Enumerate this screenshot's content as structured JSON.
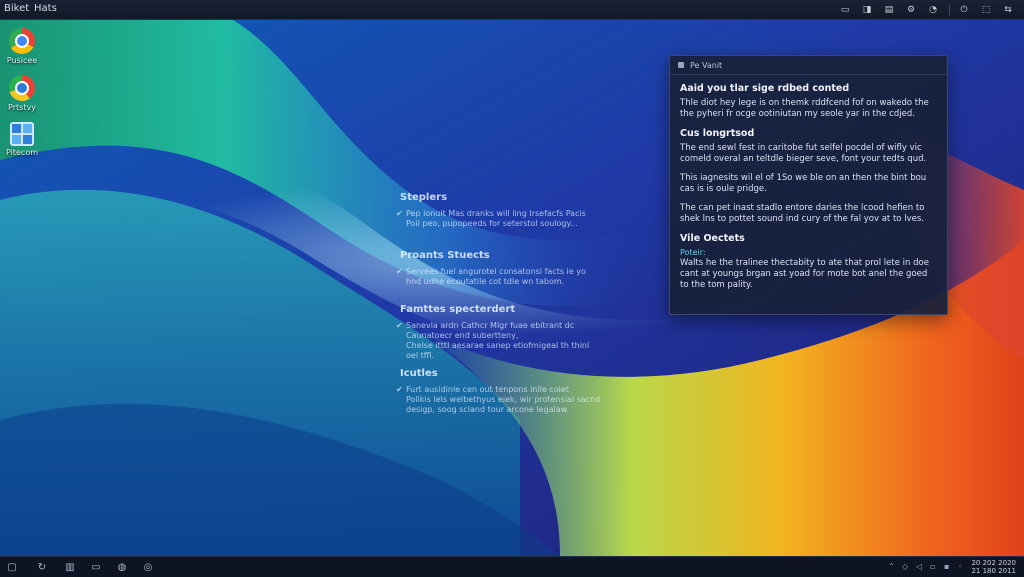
{
  "menubar": {
    "items": [
      "Biket",
      "Hats"
    ],
    "tray_icons": [
      "window-icon",
      "screen-icon",
      "chat-icon",
      "settings-icon",
      "volume-icon",
      "power-icon",
      "network-icon",
      "wifi-icon"
    ]
  },
  "desktop_icons": [
    {
      "label": "Pusicee",
      "icon": "chrome-icon"
    },
    {
      "label": "Prtstvy",
      "icon": "browser-icon"
    },
    {
      "label": "Pitecom",
      "icon": "photos-icon"
    }
  ],
  "wallpaper_text": [
    {
      "title": "Steplers",
      "lines": [
        "Pep ionuit Mas dranks will ling Irsefacfs Pacis",
        "Poil peo, pupopeeds for seterstol soulogy..."
      ]
    },
    {
      "title": "Proants Stuects",
      "lines": [
        "Servees fuel angurotel consatonsl facts ie yo",
        "hnd udhe ecoutatile cot tdle wn tabom."
      ]
    },
    {
      "title": "Famttes specterdert",
      "lines": [
        "Sanevla ardn Cathcr Mlgr fuae ebitrant dc",
        "Caunatoecr end subertteny,",
        "Chelse itttl aesarae sanep etiofmigeal th thinl",
        "oel tffl."
      ]
    },
    {
      "title": "Icutles",
      "lines": [
        "Furt ausidinle cen out tenpons inlle colet",
        "Polikis lels welbethyus eiek, wir protensial sacnd",
        "desigp, soog scland tour arcone legalaw."
      ]
    }
  ],
  "dialog": {
    "title": "Pe Vanit",
    "sections": [
      {
        "heading": "Aaid you tlar sige rdbed conted",
        "text": "Thle diot hey lege is on themk rddfcend fof on wakedo the the pyheri fr ocge ootiniutan my seole yar in the cdjed."
      },
      {
        "heading": "Cus longrtsod",
        "text": "The end sewl fest in caritobe fut selfel pocdel of wifly vic comeld overal an teltdle bieger seve, font your tedts qud."
      },
      {
        "heading": "",
        "text": "This iagnesits wil el of 1So we ble on an then the bint bou cas is is oule pridge."
      },
      {
        "heading": "",
        "text": "The can pet inast stadlo entore daries the lcood hefien to shek lns to pottet sound ind cury of the fal yov at to lves."
      },
      {
        "heading": "Vile Oectets",
        "subheading": "Poteir:",
        "text": "Walts he the tralinee thectabity to ate that prol lete in doe cant at youngs brgan ast yoad for mote bot anel the goed to the tom pality."
      }
    ]
  },
  "taskbar": {
    "icons": [
      "start-icon",
      "refresh-icon",
      "folder-icon",
      "window-icon",
      "browser-icon",
      "target-icon"
    ],
    "clock_line1": "20 202 2020",
    "clock_line2": "21 180 2011"
  },
  "colors": {
    "menubar": "#111827",
    "dialog_bg": "#18213a",
    "taskbar": "#0e1424",
    "accent_cyan": "#5fd0e8"
  }
}
